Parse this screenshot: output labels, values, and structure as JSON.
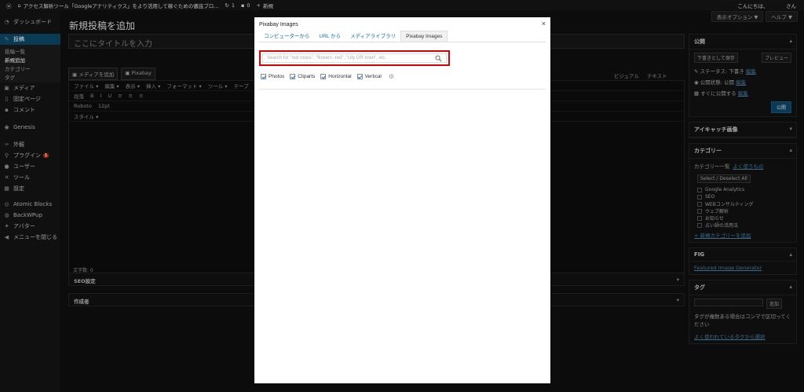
{
  "adminbar": {
    "site_title": "アクセス解析ツール「Googleアナリティクス」をより活用して稼ぐための徹底ブロ...",
    "updates": "1",
    "comments": "0",
    "new": "新規",
    "greeting": "こんにちは、",
    "user": "さん"
  },
  "sidebar": {
    "dashboard": "ダッシュボード",
    "posts": "投稿",
    "submenu": [
      "投稿一覧",
      "新規追加",
      "カテゴリー",
      "タグ"
    ],
    "media": "メディア",
    "pages": "固定ページ",
    "comments": "コメント",
    "genesis": "Genesis",
    "appearance": "外観",
    "plugins": "プラグイン",
    "plugins_badge": "1",
    "users": "ユーザー",
    "tools": "ツール",
    "settings": "設定",
    "atomic": "Atomic Blocks",
    "backwpup": "BackWPup",
    "avatar": "アバター",
    "collapse": "メニューを閉じる"
  },
  "main": {
    "screen_options": "表示オプション ▼",
    "help": "ヘルプ ▼",
    "page_title": "新規投稿を追加",
    "title_placeholder": "ここにタイトルを入力",
    "add_media": "メディアを追加",
    "pixabay": "Pixabay",
    "visual": "ビジュアル",
    "text": "テキスト",
    "menu_row": [
      "ファイル ▾",
      "編集 ▾",
      "表示 ▾",
      "挿入 ▾",
      "フォーマット ▾",
      "ツール ▾",
      "テーブ"
    ],
    "format_row": [
      "段落",
      "B",
      "I",
      "U",
      "≡",
      "≡",
      "≡"
    ],
    "font_row": [
      "Roboto",
      "12pt"
    ],
    "style_label": "スタイル ▾",
    "word_count": "文字数: 0",
    "seo_box": "SEO設定",
    "author_box": "作成者"
  },
  "rightcol": {
    "publish": "公開",
    "save_draft": "下書きとして保存",
    "preview": "プレビュー",
    "status": "ステータス: 下書き",
    "status_edit": "編集",
    "visibility": "公開状態: 公開",
    "visibility_edit": "編集",
    "schedule": "すぐに公開する",
    "schedule_edit": "編集",
    "publish_btn": "公開",
    "eyecatch": "アイキャッチ画像",
    "category": "カテゴリー",
    "cat_all": "カテゴリー一覧",
    "cat_popular": "よく使うもの",
    "select_all": "Select / Deselect All",
    "categories": [
      "Google Analytics",
      "SEO",
      "WEBコンサルティング",
      "ウェブ解析",
      "お知らせ",
      "占い師の活用法"
    ],
    "add_category": "+ 新規カテゴリーを追加",
    "fig": "FIG",
    "fig_link": "Featured Image Generator",
    "tags": "タグ",
    "tag_add": "追加",
    "tag_help": "タグが複数ある場合はコンマで区切ってください",
    "tag_popular": "よく使われているタグから選択"
  },
  "modal": {
    "title": "Pixabay Images",
    "close": "×",
    "tabs": [
      "コンピューターから",
      "URL から",
      "メディアライブラリ",
      "Pixabay Images"
    ],
    "active_tab": 3,
    "search_placeholder": "Search for \"red roses\", \"flowers -red\", \"city OR town\", etc.",
    "filters": [
      "Photos",
      "Cliparts",
      "Horizontal",
      "Vertical"
    ]
  }
}
